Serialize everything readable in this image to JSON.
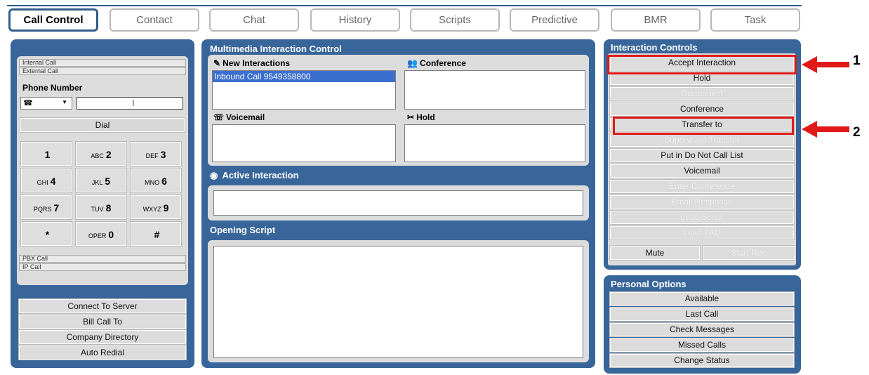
{
  "tabs": [
    {
      "label": "Call Control",
      "active": true
    },
    {
      "label": "Contact"
    },
    {
      "label": "Chat"
    },
    {
      "label": "History"
    },
    {
      "label": "Scripts"
    },
    {
      "label": "Predictive"
    },
    {
      "label": "BMR"
    },
    {
      "label": "Task"
    }
  ],
  "phone": {
    "slats_top": [
      "Internal Call",
      "External Call"
    ],
    "phone_number_label": "Phone Number",
    "input_value": "",
    "dial_label": "Dial",
    "keys": [
      {
        "sub": "",
        "main": "1"
      },
      {
        "sub": "ABC",
        "main": "2"
      },
      {
        "sub": "DEF",
        "main": "3"
      },
      {
        "sub": "GHI",
        "main": "4"
      },
      {
        "sub": "JKL",
        "main": "5"
      },
      {
        "sub": "MNO",
        "main": "6"
      },
      {
        "sub": "PQRS",
        "main": "7"
      },
      {
        "sub": "TUV",
        "main": "8"
      },
      {
        "sub": "WXYZ",
        "main": "9"
      },
      {
        "sub": "",
        "main": "*"
      },
      {
        "sub": "OPER",
        "main": "0"
      },
      {
        "sub": "",
        "main": "#"
      }
    ],
    "slats_bottom": [
      "PBX Call",
      "IP Call"
    ],
    "actions": [
      "Connect To Server",
      "Bill Call To",
      "Company Directory",
      "Auto Redial"
    ]
  },
  "multimedia": {
    "title": "Multimedia Interaction Control",
    "new_interactions_label": "New Interactions",
    "new_interactions_items": [
      "Inbound Call 9549358800"
    ],
    "conference_label": "Conference",
    "voicemail_label": "Voicemail",
    "hold_label": "Hold",
    "active_interaction_label": "Active Interaction",
    "opening_script_label": "Opening Script"
  },
  "interaction_controls": {
    "title": "Interaction Controls",
    "buttons": [
      {
        "label": "Accept Interaction",
        "enabled": true
      },
      {
        "label": "Hold",
        "enabled": true
      },
      {
        "label": "Disconnect",
        "enabled": false
      },
      {
        "label": "Conference",
        "enabled": true
      },
      {
        "label": "Transfer to",
        "enabled": true
      },
      {
        "label": "Supervised Transfer",
        "enabled": false
      },
      {
        "label": "Put in Do Not Call List",
        "enabled": true
      },
      {
        "label": "Voicemail",
        "enabled": true
      },
      {
        "label": "Enter Conference",
        "enabled": false
      },
      {
        "label": "Email Response",
        "enabled": false
      },
      {
        "label": "Load Script",
        "enabled": false
      },
      {
        "label": "Load FAQ",
        "enabled": false
      }
    ],
    "mute_label": "Mute",
    "start_rec_label": "Start Rec"
  },
  "personal_options": {
    "title": "Personal Options",
    "buttons": [
      "Available",
      "Last Call",
      "Check Messages",
      "Missed Calls",
      "Change Status"
    ]
  },
  "callouts": [
    "1",
    "2"
  ],
  "colors": {
    "accent": "#38669a",
    "highlight": "#e01919",
    "selection": "#3a6fd0"
  }
}
